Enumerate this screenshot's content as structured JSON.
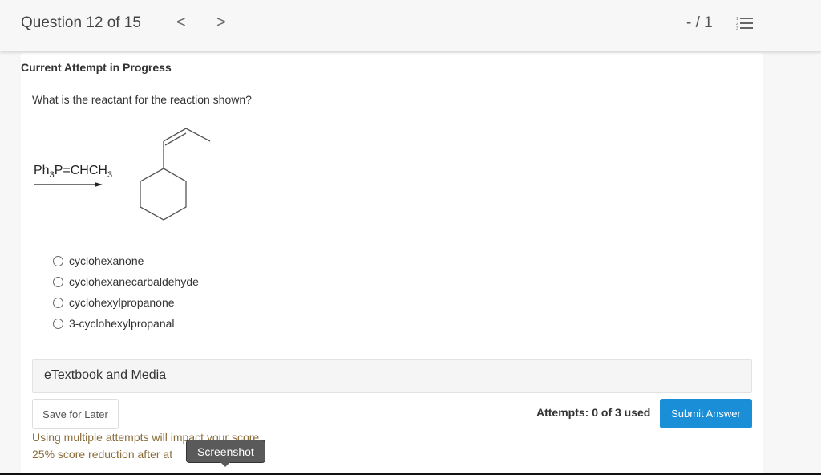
{
  "header": {
    "question_label": "Question 12 of 15",
    "prev_icon": "chevron-left-icon",
    "next_icon": "chevron-right-icon",
    "prev_glyph": "<",
    "next_glyph": ">",
    "score": "- / 1",
    "list_icon": "numbered-list-icon"
  },
  "main": {
    "attempt_header": "Current Attempt in Progress",
    "question": "What is the reactant for the reaction shown?",
    "reaction": {
      "reagent_prefix": "Ph",
      "reagent_sub1": "3",
      "reagent_mid": "P=CHCH",
      "reagent_sub2": "3",
      "product": "cyclohexyl-propene (Z)"
    },
    "options": [
      {
        "label": "cyclohexanone",
        "selected": false
      },
      {
        "label": "cyclohexanecarbaldehyde",
        "selected": false
      },
      {
        "label": "cyclohexylpropanone",
        "selected": false
      },
      {
        "label": "3-cyclohexylpropanal",
        "selected": false
      }
    ],
    "etextbook_label": "eTextbook and Media",
    "save_label": "Save for Later",
    "attempts_label": "Attempts: 0 of 3 used",
    "submit_label": "Submit Answer",
    "warning_line1": "Using multiple attempts will impact your score.",
    "warning_line2": "25% score reduction after at",
    "tooltip": "Screenshot"
  },
  "colors": {
    "submit": "#1a8fd8",
    "warning": "#8a6d3b"
  }
}
